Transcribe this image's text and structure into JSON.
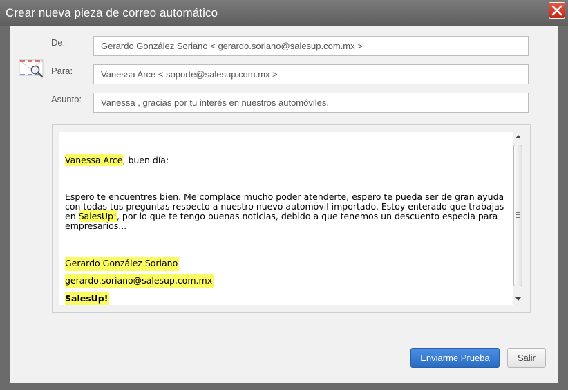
{
  "dialog": {
    "title": "Crear nueva pieza de correo automático"
  },
  "form": {
    "from_label": "De:",
    "from_value": "Gerardo González Soriano < gerardo.soriano@salesup.com.mx >",
    "to_label": "Para:",
    "to_value": "Vanessa Arce < soporte@salesup.com.mx >",
    "subject_label": "Asunto:",
    "subject_value": "Vanessa , gracias por tu interés en nuestros automóviles."
  },
  "body": {
    "greeting_name": "Vanessa Arce",
    "greeting_rest": ", buen día:",
    "para_before": "Espero te encuentres bien. Me complace mucho poder atenderte, espero te pueda ser de gran ayuda con todas tus preguntas respecto a nuestro nuevo automóvil importado. Estoy enterado que trabajas en ",
    "para_company": "SalesUp!",
    "para_after": ", por lo que te tengo buenas noticias, debido a que tenemos un descuento especia para empresarios...",
    "sig_name": "Gerardo González Soriano",
    "sig_email": "gerardo.soriano@salesup.com.mx",
    "sig_company": "SalesUp!"
  },
  "buttons": {
    "send_test": "Enviarme Prueba",
    "exit": "Salir"
  },
  "icons": {
    "close": "close-icon",
    "envelope": "envelope-search-icon"
  },
  "colors": {
    "titlebar": "#6b6b6b",
    "primary_button": "#3a7fd5",
    "highlight": "#fbfb62",
    "close_button": "#d43a28"
  }
}
